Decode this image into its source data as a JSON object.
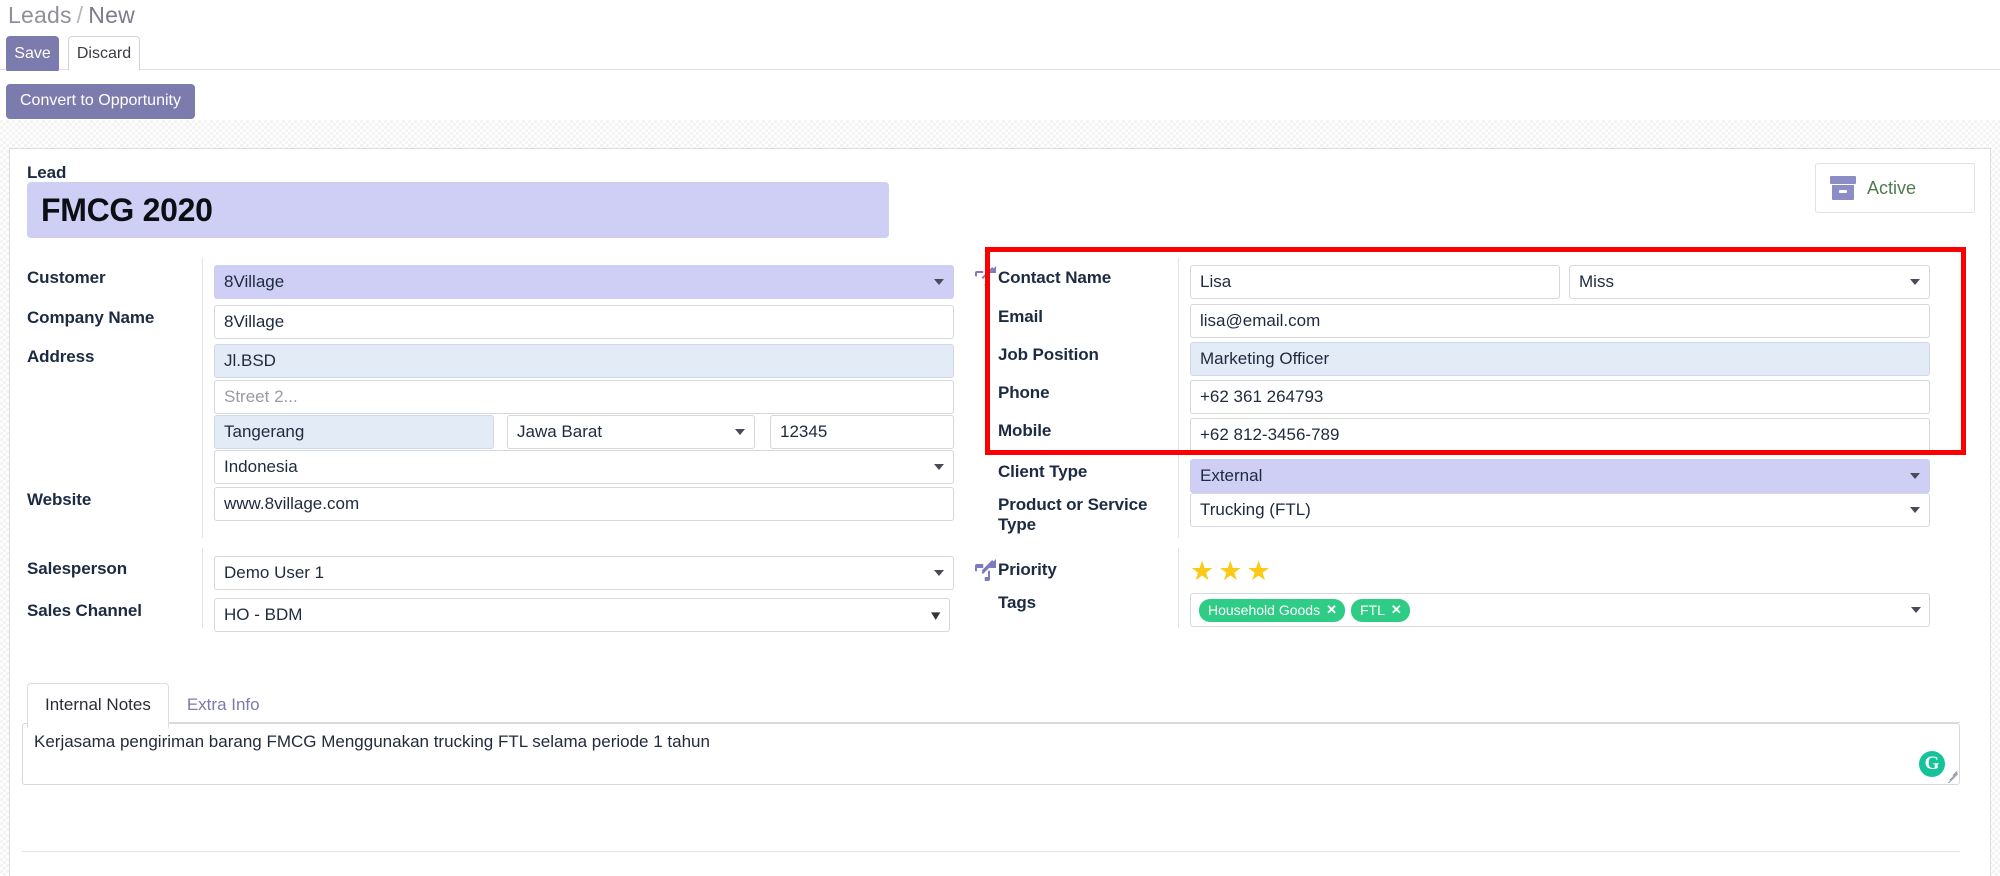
{
  "breadcrumb": {
    "root": "Leads",
    "separator": "/",
    "current": "New"
  },
  "toolbar": {
    "save_label": "Save",
    "discard_label": "Discard",
    "convert_label": "Convert to Opportunity"
  },
  "status": {
    "label": "Active",
    "icon": "archive-box-icon",
    "color": "#4e7c4e"
  },
  "lead": {
    "label": "Lead",
    "title": "FMCG 2020"
  },
  "left_column": {
    "customer": {
      "label": "Customer",
      "value": "8Village"
    },
    "company_name": {
      "label": "Company Name",
      "value": "8Village"
    },
    "address": {
      "label": "Address",
      "street": "Jl.BSD",
      "street2_placeholder": "Street 2...",
      "city": "Tangerang",
      "state": "Jawa Barat",
      "zip": "12345",
      "country": "Indonesia"
    },
    "website": {
      "label": "Website",
      "value": "www.8village.com"
    },
    "salesperson": {
      "label": "Salesperson",
      "value": "Demo User 1"
    },
    "sales_channel": {
      "label": "Sales Channel",
      "value": "HO - BDM"
    }
  },
  "right_column": {
    "contact_name": {
      "label": "Contact Name",
      "value": "Lisa",
      "title": "Miss"
    },
    "email": {
      "label": "Email",
      "value": "lisa@email.com"
    },
    "job_position": {
      "label": "Job Position",
      "value": "Marketing Officer"
    },
    "phone": {
      "label": "Phone",
      "value": "+62 361 264793"
    },
    "mobile": {
      "label": "Mobile",
      "value": "+62 812-3456-789"
    },
    "client_type": {
      "label": "Client Type",
      "value": "External"
    },
    "product_service_type": {
      "label_line1": "Product or Service",
      "label_line2": "Type",
      "value": "Trucking (FTL)"
    },
    "priority": {
      "label": "Priority",
      "stars_filled": 3,
      "stars_total": 3,
      "star_color": "#fcc917"
    },
    "tags": {
      "label": "Tags",
      "items": [
        "Household Goods",
        "FTL"
      ],
      "color": "#2ecc84"
    }
  },
  "notebook": {
    "tabs": [
      {
        "label": "Internal Notes",
        "active": true
      },
      {
        "label": "Extra Info",
        "active": false
      }
    ],
    "internal_notes": "Kerjasama pengiriman barang FMCG Menggunakan trucking FTL selama periode 1 tahun",
    "grammarly_icon": "G"
  },
  "annotation": {
    "highlight_color": "#fc0000"
  }
}
